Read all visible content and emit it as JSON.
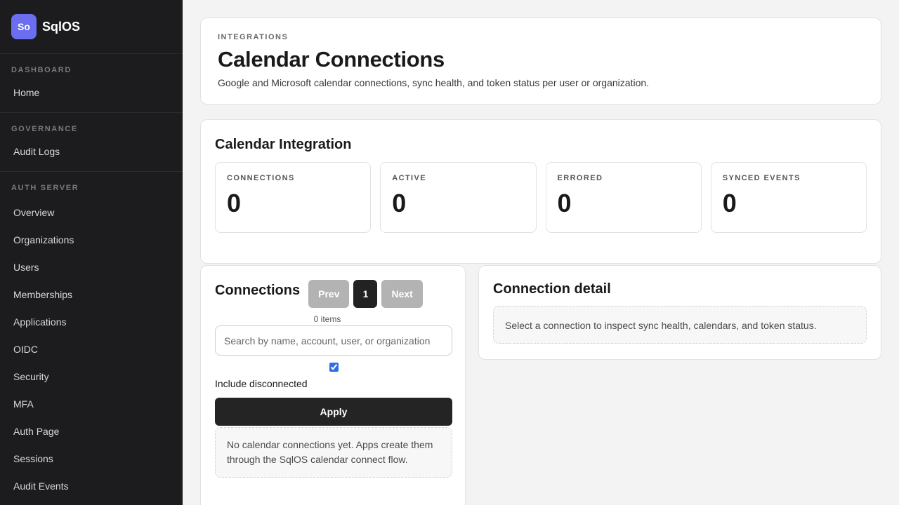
{
  "brand": {
    "logo": "So",
    "name": "SqlOS"
  },
  "sidebar": {
    "sections": [
      {
        "heading": "DASHBOARD",
        "items": [
          "Home"
        ]
      },
      {
        "heading": "GOVERNANCE",
        "items": [
          "Audit Logs"
        ]
      },
      {
        "heading": "AUTH SERVER",
        "items": [
          "Overview",
          "Organizations",
          "Users",
          "Memberships",
          "Applications",
          "OIDC",
          "Security",
          "MFA",
          "Auth Page",
          "Sessions",
          "Audit Events"
        ]
      }
    ]
  },
  "header": {
    "eyebrow": "INTEGRATIONS",
    "title": "Calendar Connections",
    "description": "Google and Microsoft calendar connections, sync health, and token status per user or organization."
  },
  "integration": {
    "title": "Calendar Integration",
    "stats": [
      {
        "label": "CONNECTIONS",
        "value": "0"
      },
      {
        "label": "ACTIVE",
        "value": "0"
      },
      {
        "label": "ERRORED",
        "value": "0"
      },
      {
        "label": "SYNCED EVENTS",
        "value": "0"
      }
    ]
  },
  "connections": {
    "title": "Connections",
    "prev_label": "Prev",
    "page_label": "1",
    "next_label": "Next",
    "item_count": "0 items",
    "search_placeholder": "Search by name, account, user, or organization",
    "include_disconnected_label": "Include disconnected",
    "include_disconnected_checked": true,
    "apply_label": "Apply",
    "empty_text": "No calendar connections yet. Apps create them through the SqlOS calendar connect flow."
  },
  "detail": {
    "title": "Connection detail",
    "empty_text": "Select a connection to inspect sync health, calendars, and token status."
  },
  "colors": {
    "sidebar_bg": "#1c1c1e",
    "brand_accent": "#6b6ef0",
    "primary_button": "#242424",
    "disabled_button": "#b3b3b3"
  }
}
